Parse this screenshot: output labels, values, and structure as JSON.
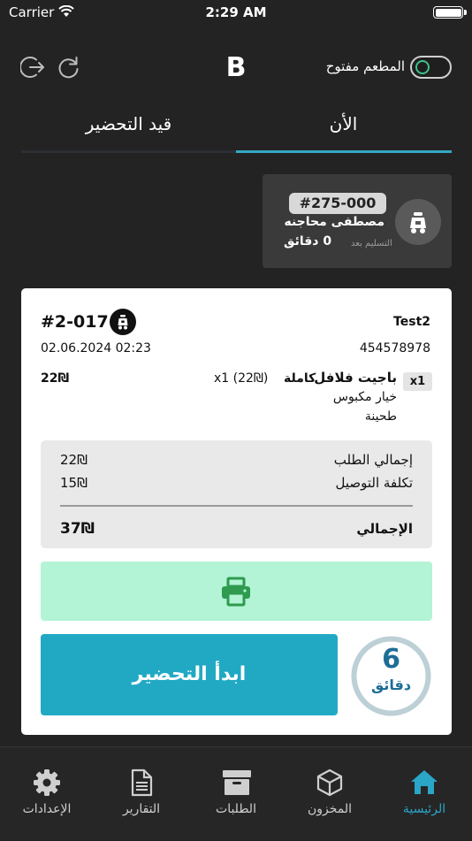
{
  "status_bar": {
    "carrier": "Carrier",
    "time": "2:29 AM"
  },
  "header": {
    "logo": "B",
    "restaurant_status_label": "المطعم مفتوح",
    "restaurant_open": true
  },
  "tabs": [
    {
      "label": "الأن",
      "active": true
    },
    {
      "label": "قيد التحضير",
      "active": false
    }
  ],
  "pending_order": {
    "number": "#275-000",
    "customer": "مصطفى محاجنه",
    "delivery_label": "التسليم بعد",
    "delivery_time": "0 دقائق",
    "icon": "scooter-icon"
  },
  "order": {
    "id": "#2-017",
    "customer_name": "Test2",
    "date": "02.06.2024 02:23",
    "phone": "454578978",
    "line_item": {
      "qty": "x1",
      "name": "باجيت فلافل",
      "size": "كاملة",
      "unit": "x1 (22₪)",
      "price": "22₪",
      "options": [
        "خيار مكبوس",
        "طحينة"
      ]
    },
    "summary": {
      "subtotal_label": "إجمالي الطلب",
      "subtotal": "22₪",
      "delivery_label": "تكلفة التوصيل",
      "delivery": "15₪",
      "total_label": "الإجمالي",
      "total": "37₪"
    },
    "start_button": "ابدأ التحضير",
    "timer": {
      "value": "6",
      "unit": "دقائق"
    }
  },
  "nav": [
    {
      "label": "الرئيسية",
      "icon": "home-icon",
      "active": true
    },
    {
      "label": "المخزون",
      "icon": "box-icon",
      "active": false
    },
    {
      "label": "الطلبات",
      "icon": "archive-icon",
      "active": false
    },
    {
      "label": "التقارير",
      "icon": "report-icon",
      "active": false
    },
    {
      "label": "الإعدادات",
      "icon": "gear-icon",
      "active": false
    }
  ],
  "colors": {
    "accent": "#21a9c4",
    "print_bg": "#b3f3d6",
    "toggle_knob": "#3fc28a",
    "background": "#232323"
  }
}
